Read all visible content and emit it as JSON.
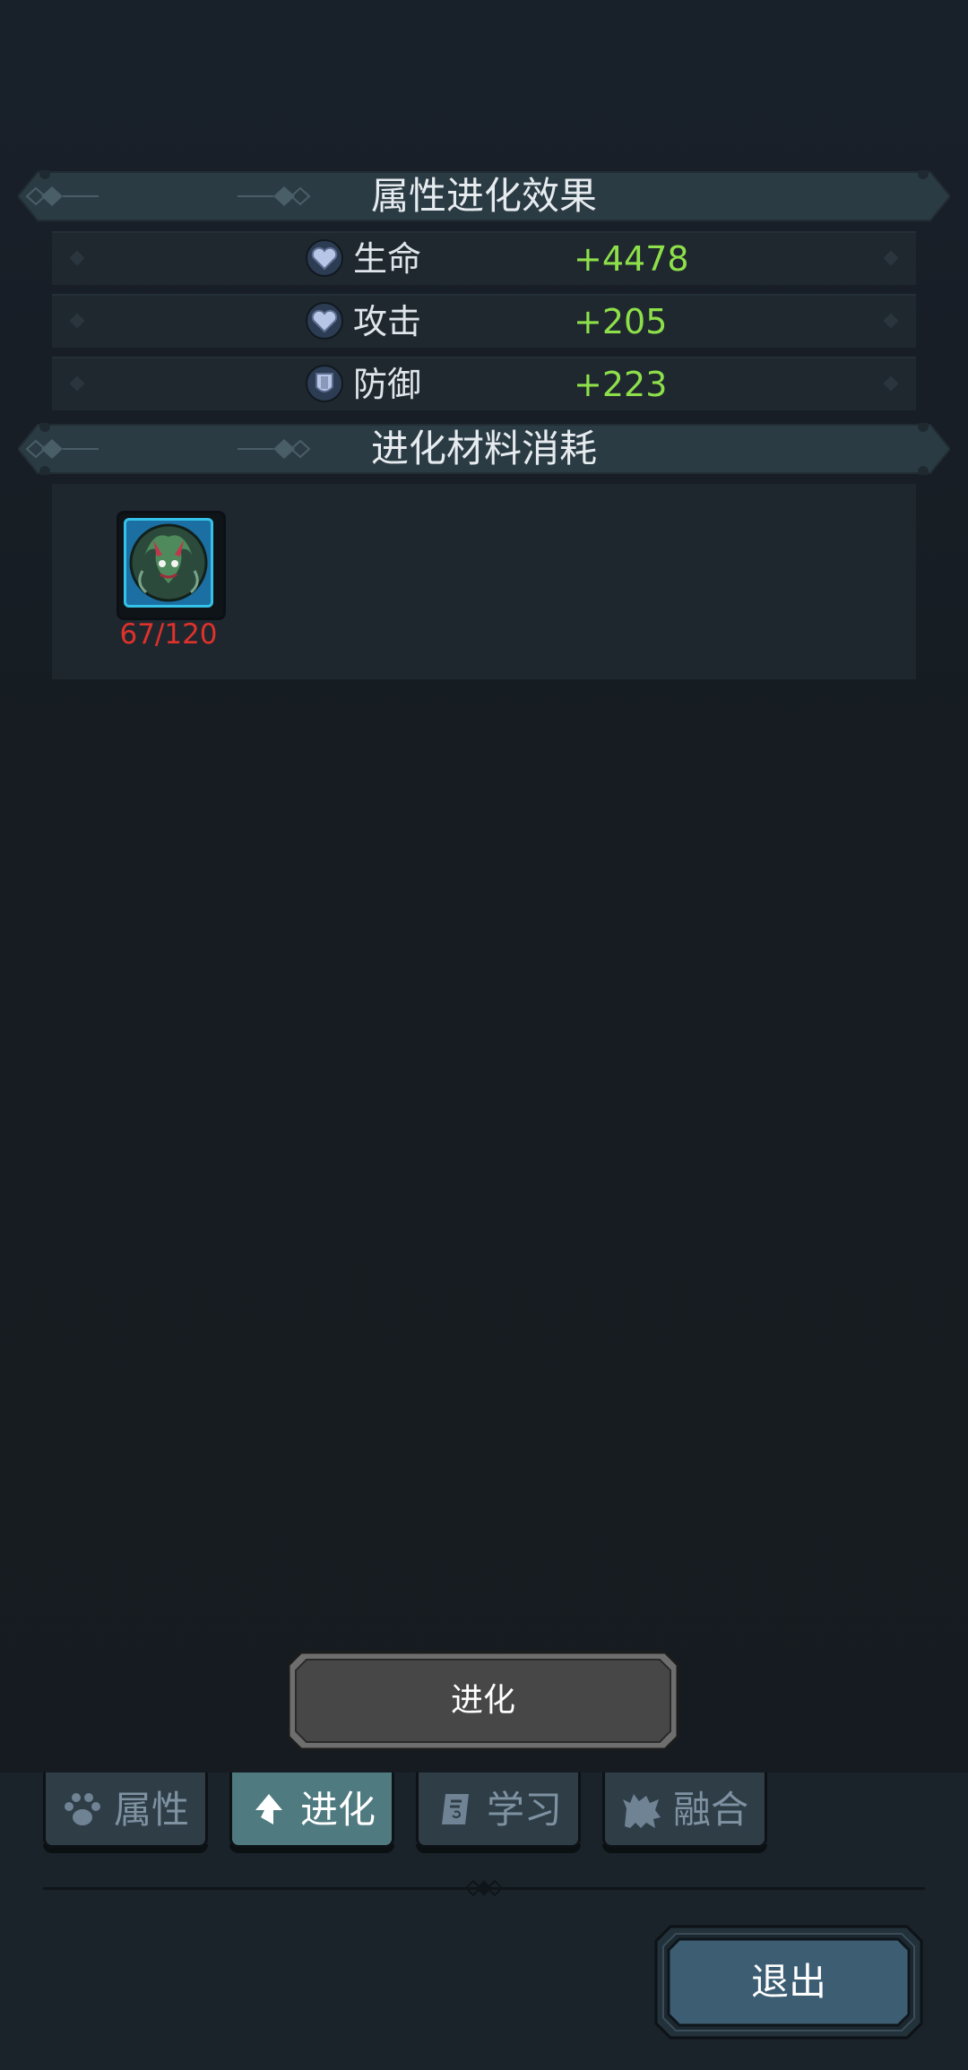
{
  "sections": {
    "effect_title": "属性进化效果",
    "material_title": "进化材料消耗"
  },
  "stats": [
    {
      "label": "生命",
      "value": "+4478",
      "icon": "heart-shield-icon"
    },
    {
      "label": "攻击",
      "value": "+205",
      "icon": "heart-shield-icon"
    },
    {
      "label": "防御",
      "value": "+223",
      "icon": "shield-icon"
    }
  ],
  "material": {
    "icon": "creature-portrait-icon",
    "count": "67/120"
  },
  "evolve_button": "进化",
  "tabs": [
    {
      "label": "属性",
      "icon": "paw-icon",
      "active": false
    },
    {
      "label": "进化",
      "icon": "arrow-up-icon",
      "active": true
    },
    {
      "label": "学习",
      "icon": "book-icon",
      "active": false
    },
    {
      "label": "融合",
      "icon": "monster-icon",
      "active": false
    }
  ],
  "exit_button": "退出",
  "colors": {
    "stat_value": "#8ee04a",
    "material_insufficient": "#e0312b",
    "active_tab": "#4e7a80",
    "exit_button": "#3c5d72"
  }
}
